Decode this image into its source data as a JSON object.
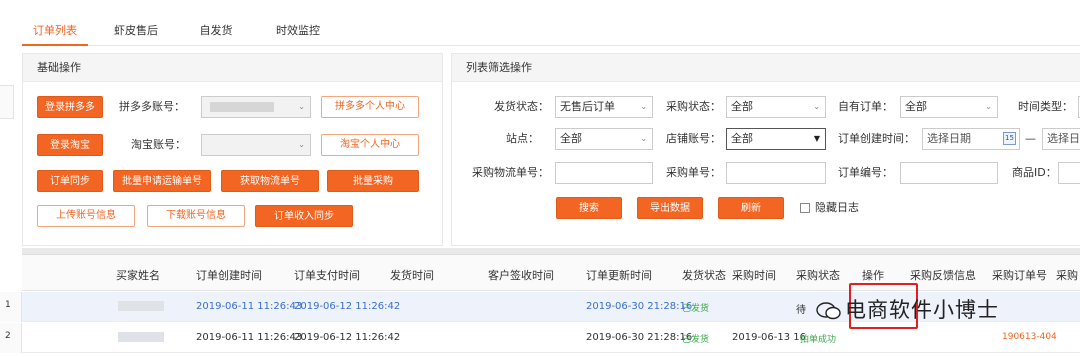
{
  "tabs": [
    "订单列表",
    "虾皮售后",
    "自发货",
    "时效监控"
  ],
  "basic": {
    "title": "基础操作",
    "login_pdd": "登录拼多多",
    "pdd_account_label": "拼多多账号：",
    "pdd_center": "拼多多个人中心",
    "login_taobao": "登录淘宝",
    "taobao_account_label": "淘宝账号：",
    "taobao_center": "淘宝个人中心",
    "order_sync": "订单同步",
    "batch_apply_tracking": "批量申请运输单号",
    "get_logistics_no": "获取物流单号",
    "batch_purchase": "批量采购",
    "upload_account": "上传账号信息",
    "download_account": "下载账号信息",
    "order_income_sync": "订单收入同步"
  },
  "filter": {
    "title": "列表筛选操作",
    "ship_status_label": "发货状态：",
    "ship_status_value": "无售后订单",
    "purchase_status_label": "采购状态：",
    "purchase_status_value": "全部",
    "own_order_label": "自有订单：",
    "own_order_value": "全部",
    "time_type_label": "时间类型：",
    "site_label": "站点：",
    "site_value": "全部",
    "shop_account_label": "店铺账号：",
    "shop_account_value": "全部",
    "create_time_label": "订单创建时间：",
    "date_placeholder": "选择日期",
    "date_sep": "—",
    "date_placeholder2": "选择日",
    "purchase_logistics_label": "采购物流单号：",
    "purchase_order_label": "采购单号：",
    "order_no_label": "订单编号：",
    "product_id_label": "商品ID：",
    "search": "搜索",
    "export": "导出数据",
    "refresh": "刷新",
    "hide_log": "隐藏日志"
  },
  "grid": {
    "headers": [
      "买家姓名",
      "订单创建时间",
      "订单支付时间",
      "发货时间",
      "客户签收时间",
      "订单更新时间",
      "发货状态",
      "采购时间",
      "采购状态",
      "操作",
      "采购反馈信息",
      "采购订单号",
      "采购"
    ],
    "rows": [
      {
        "num": "1",
        "create": "2019-06-11 11:26:43",
        "pay": "2019-06-12 11:26:42",
        "update": "2019-06-30 21:28:16",
        "ship_status": "已发货",
        "purchase_time": "",
        "purchase_status": "待",
        "purchase_no": ""
      },
      {
        "num": "2",
        "create": "2019-06-11 11:26:43",
        "pay": "2019-06-12 11:26:42",
        "update": "2019-06-30 21:28:16",
        "ship_status": "已发货",
        "purchase_time": "2019-06-13 16",
        "purchase_status": "拍单成功",
        "purchase_no": "190613-404"
      }
    ]
  },
  "watermark": "电商软件小博士"
}
